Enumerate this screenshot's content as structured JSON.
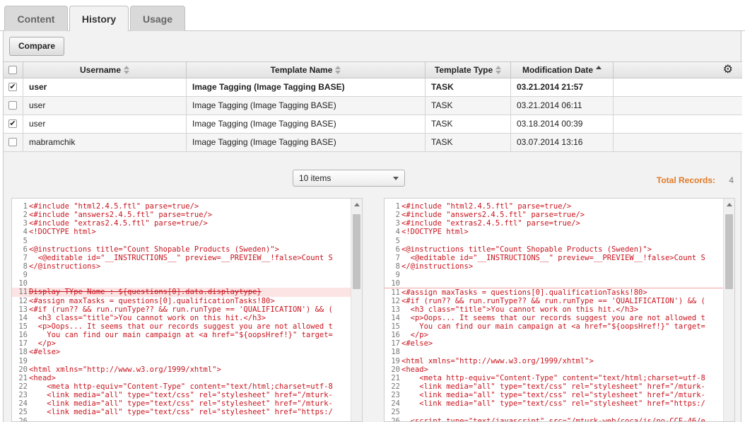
{
  "tabs": [
    {
      "label": "Content",
      "active": false
    },
    {
      "label": "History",
      "active": true
    },
    {
      "label": "Usage",
      "active": false
    }
  ],
  "toolbar": {
    "compare_label": "Compare"
  },
  "table": {
    "columns": [
      "Username",
      "Template Name",
      "Template Type",
      "Modification Date"
    ],
    "sort": {
      "column": "Modification Date",
      "direction": "descending"
    },
    "rows": [
      {
        "checked": true,
        "username": "user",
        "template_name": "Image Tagging (Image Tagging BASE)",
        "template_type": "TASK",
        "modified": "03.21.2014 21:57",
        "current": true
      },
      {
        "checked": false,
        "username": "user",
        "template_name": "Image Tagging (Image Tagging BASE)",
        "template_type": "TASK",
        "modified": "03.21.2014 06:11",
        "current": false
      },
      {
        "checked": true,
        "username": "user",
        "template_name": "Image Tagging (Image Tagging BASE)",
        "template_type": "TASK",
        "modified": "03.18.2014 00:39",
        "current": false
      },
      {
        "checked": false,
        "username": "mabramchik",
        "template_name": "Image Tagging (Image Tagging BASE)",
        "template_type": "TASK",
        "modified": "03.07.2014 13:16",
        "current": false
      }
    ]
  },
  "pager": {
    "items_selected": "10 items",
    "total_label": "Total Records:",
    "total_value": "4"
  },
  "diff": {
    "left": [
      {
        "n": "1",
        "text": "<#include \"html2.4.5.ftl\" parse=true/>"
      },
      {
        "n": "2",
        "text": "<#include \"answers2.4.5.ftl\" parse=true/>"
      },
      {
        "n": "3",
        "text": "<#include \"extras2.4.5.ftl\" parse=true/>"
      },
      {
        "n": "4",
        "text": "<!DOCTYPE html>"
      },
      {
        "n": "5",
        "text": ""
      },
      {
        "n": "6",
        "text": "<@instructions title=\"Count Shopable Products (Sweden)\">"
      },
      {
        "n": "7",
        "text": "  <@editable id=\"__INSTRUCTIONS__\" preview=__PREVIEW__!false>Count S"
      },
      {
        "n": "8",
        "text": "</@instructions>"
      },
      {
        "n": "9",
        "text": ""
      },
      {
        "n": "10",
        "text": ""
      },
      {
        "n": "11",
        "text": "Display TYpe Name : ${questions[0].data.displaytype}",
        "deleted": true
      },
      {
        "n": "12",
        "text": "<#assign maxTasks = questions[0].qualificationTasks!80>"
      },
      {
        "n": "13",
        "text": "<#if (run?? && run.runType?? && run.runType == 'QUALIFICATION') && ("
      },
      {
        "n": "14",
        "text": "  <h3 class=\"title\">You cannot work on this hit.</h3>"
      },
      {
        "n": "15",
        "text": "  <p>Oops... It seems that our records suggest you are not allowed t"
      },
      {
        "n": "16",
        "text": "    You can find our main campaign at <a href=\"${oopsHref!}\" target="
      },
      {
        "n": "17",
        "text": "  </p>"
      },
      {
        "n": "18",
        "text": "<#else>"
      },
      {
        "n": "19",
        "text": ""
      },
      {
        "n": "20",
        "text": "<html xmlns=\"http://www.w3.org/1999/xhtml\">"
      },
      {
        "n": "21",
        "text": "<head>"
      },
      {
        "n": "22",
        "text": "    <meta http-equiv=\"Content-Type\" content=\"text/html;charset=utf-8"
      },
      {
        "n": "23",
        "text": "    <link media=\"all\" type=\"text/css\" rel=\"stylesheet\" href=\"/mturk-"
      },
      {
        "n": "24",
        "text": "    <link media=\"all\" type=\"text/css\" rel=\"stylesheet\" href=\"/mturk-"
      },
      {
        "n": "25",
        "text": "    <link media=\"all\" type=\"text/css\" rel=\"stylesheet\" href=\"https:/"
      },
      {
        "n": "26",
        "text": ""
      }
    ],
    "right": [
      {
        "n": "1",
        "text": "<#include \"html2.4.5.ftl\" parse=true/>"
      },
      {
        "n": "2",
        "text": "<#include \"answers2.4.5.ftl\" parse=true/>"
      },
      {
        "n": "3",
        "text": "<#include \"extras2.4.5.ftl\" parse=true/>"
      },
      {
        "n": "4",
        "text": "<!DOCTYPE html>"
      },
      {
        "n": "5",
        "text": ""
      },
      {
        "n": "6",
        "text": "<@instructions title=\"Count Shopable Products (Sweden)\">"
      },
      {
        "n": "7",
        "text": "  <@editable id=\"__INSTRUCTIONS__\" preview=__PREVIEW__!false>Count S"
      },
      {
        "n": "8",
        "text": "</@instructions>"
      },
      {
        "n": "9",
        "text": ""
      },
      {
        "n": "10",
        "text": ""
      },
      {
        "n": "11",
        "text": "<#assign maxTasks = questions[0].qualificationTasks!80>",
        "separator": true
      },
      {
        "n": "12",
        "text": "<#if (run?? && run.runType?? && run.runType == 'QUALIFICATION') && ("
      },
      {
        "n": "13",
        "text": "  <h3 class=\"title\">You cannot work on this hit.</h3>"
      },
      {
        "n": "14",
        "text": "  <p>Oops... It seems that our records suggest you are not allowed t"
      },
      {
        "n": "15",
        "text": "    You can find our main campaign at <a href=\"${oopsHref!}\" target="
      },
      {
        "n": "16",
        "text": "  </p>"
      },
      {
        "n": "17",
        "text": "<#else>"
      },
      {
        "n": "18",
        "text": ""
      },
      {
        "n": "19",
        "text": "<html xmlns=\"http://www.w3.org/1999/xhtml\">"
      },
      {
        "n": "20",
        "text": "<head>"
      },
      {
        "n": "21",
        "text": "    <meta http-equiv=\"Content-Type\" content=\"text/html;charset=utf-8"
      },
      {
        "n": "22",
        "text": "    <link media=\"all\" type=\"text/css\" rel=\"stylesheet\" href=\"/mturk-"
      },
      {
        "n": "23",
        "text": "    <link media=\"all\" type=\"text/css\" rel=\"stylesheet\" href=\"/mturk-"
      },
      {
        "n": "24",
        "text": "    <link media=\"all\" type=\"text/css\" rel=\"stylesheet\" href=\"https:/"
      },
      {
        "n": "25",
        "text": ""
      },
      {
        "n": "26",
        "text": "  <script type=\"text/javascript\" src=\"/mturk-web/coca/js/no-CCE-46/e"
      }
    ]
  },
  "colors": {
    "accent_total": "#e07b28",
    "code_red": "#c8141e",
    "code_blue": "#1a1aa6",
    "deleted_bg": "#fde4e4"
  }
}
